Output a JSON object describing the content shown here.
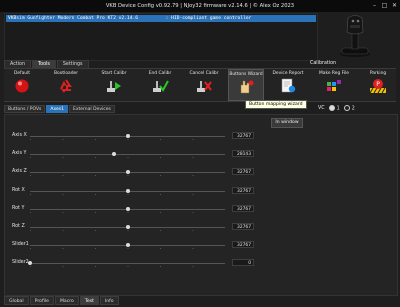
{
  "window": {
    "title": "VKB Device Config v0.92.79 | NJoy32 firmware v2.14.6 | © Alex Oz 2023",
    "controls": [
      "–",
      "□",
      "✕"
    ]
  },
  "device": {
    "selected": "VKBsim Gunfighter Modern Combat Pro KT2 v2.14.6          : HID-compliant game controller"
  },
  "top_tabs": [
    {
      "label": "Action",
      "active": false
    },
    {
      "label": "Tools",
      "active": true
    },
    {
      "label": "Settings",
      "active": false
    }
  ],
  "calibration_label": "Calibration",
  "toolbar": [
    {
      "label": "Default",
      "icon": "red-ball-icon"
    },
    {
      "label": "Bootloader",
      "icon": "recycle-icon"
    },
    {
      "label": "Start Calibr",
      "icon": "start-calibrate-icon"
    },
    {
      "label": "End Calibr",
      "icon": "end-calibrate-icon"
    },
    {
      "label": "Cancel Calibr",
      "icon": "cancel-calibrate-icon"
    },
    {
      "label": "Buttons Wizard",
      "icon": "hand-wizard-icon"
    },
    {
      "label": "Device Report",
      "icon": "device-report-icon"
    },
    {
      "label": "Make Reg File",
      "icon": "make-reg-file-icon"
    },
    {
      "label": "Parking",
      "icon": "parking-icon"
    }
  ],
  "tooltip": "Button mapping wizard",
  "sub_tabs": [
    {
      "label": "Buttons / POVs",
      "active": false
    },
    {
      "label": "Axes1",
      "active": true
    },
    {
      "label": "External Devices",
      "active": false
    }
  ],
  "vc": {
    "label": "VC",
    "options": [
      "1",
      "2"
    ],
    "selected": "1"
  },
  "in_window_button": "In window",
  "axes": [
    {
      "name": "Axis X",
      "value": "32767",
      "level": 0.5
    },
    {
      "name": "Axis Y",
      "value": "28143",
      "level": 0.43
    },
    {
      "name": "Axis Z",
      "value": "32767",
      "level": 0.5
    },
    {
      "name": "Rot X",
      "value": "32767",
      "level": 0.5
    },
    {
      "name": "Rot Y",
      "value": "32767",
      "level": 0.5
    },
    {
      "name": "Rot Z",
      "value": "32767",
      "level": 0.5
    },
    {
      "name": "Slider1",
      "value": "32767",
      "level": 0.5
    },
    {
      "name": "Slider2",
      "value": "0",
      "level": 0.0
    }
  ],
  "bottom_tabs": [
    {
      "label": "Global",
      "active": false
    },
    {
      "label": "Profile",
      "active": false
    },
    {
      "label": "Macro",
      "active": false
    },
    {
      "label": "Test",
      "active": true
    },
    {
      "label": "Info",
      "active": false
    }
  ]
}
